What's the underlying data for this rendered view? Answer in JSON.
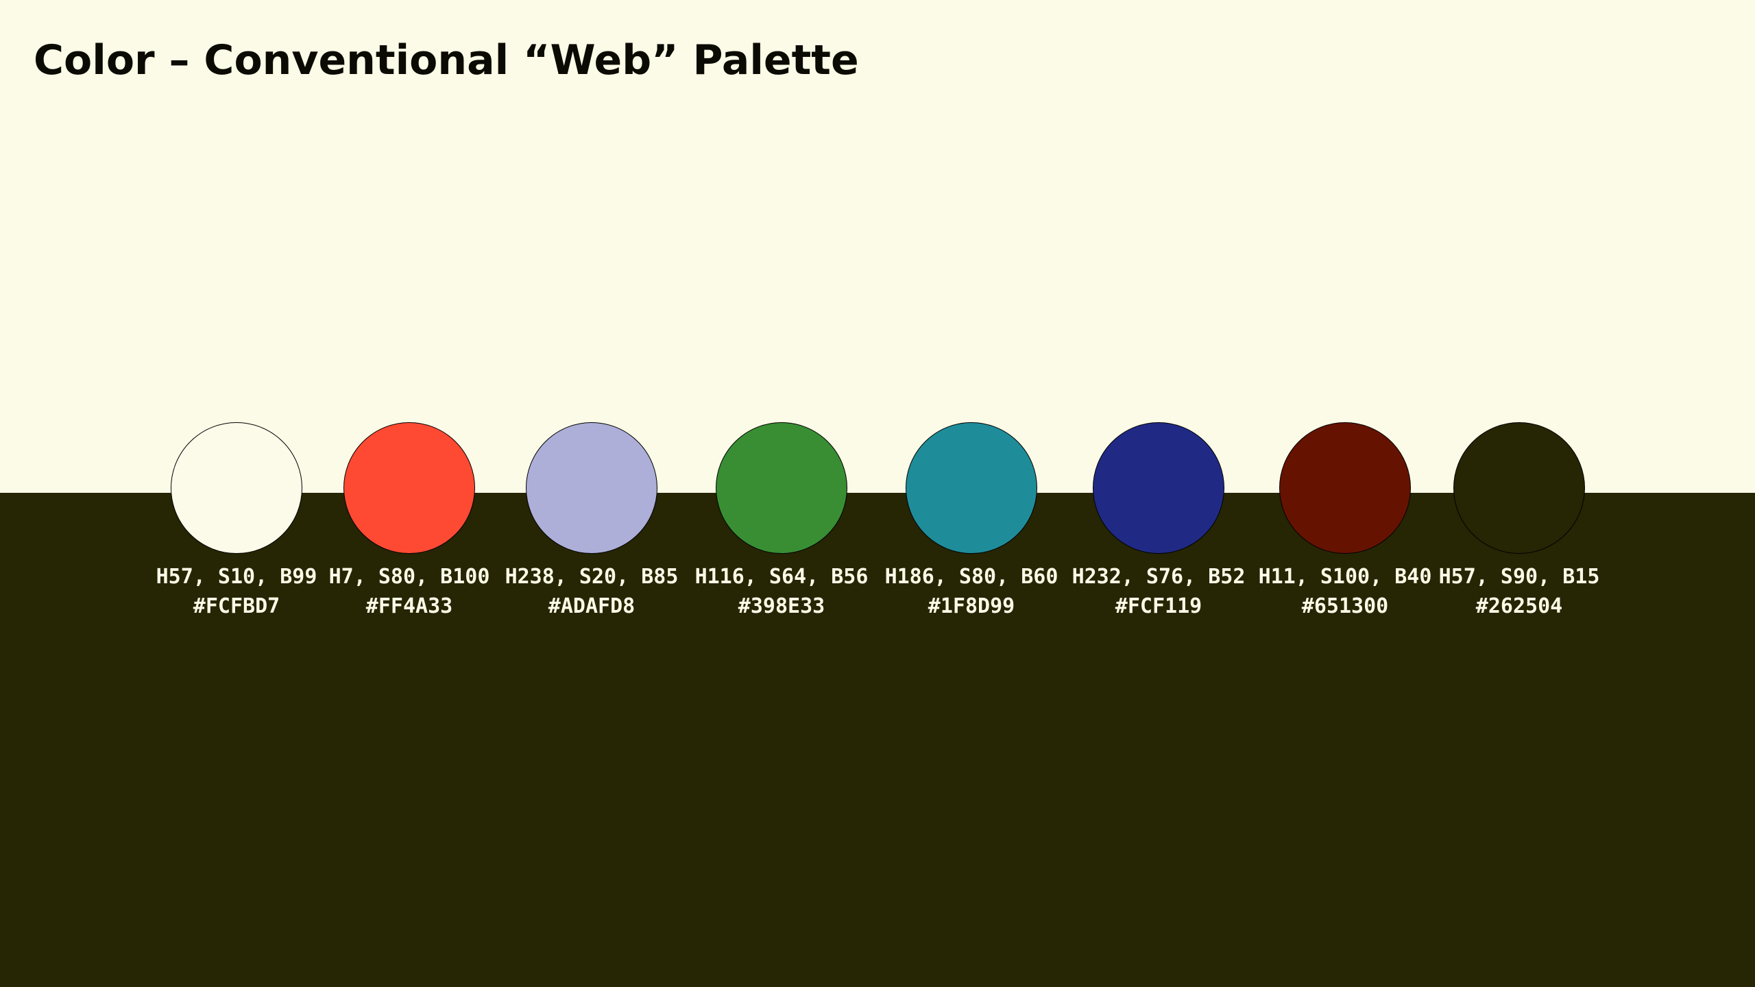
{
  "title": "Color – Conventional “Web” Palette",
  "colors": {
    "background_light": "#FCFBE7",
    "background_dark": "#262504",
    "label_text": "#FCFBE7",
    "title_text": "#0B0B04"
  },
  "swatches": [
    {
      "hsb": "H57, S10, B99",
      "hex": "#FCFBD7",
      "fill": "#FCFBE9"
    },
    {
      "hsb": "H7, S80, B100",
      "hex": "#FF4A33",
      "fill": "#FF4A33"
    },
    {
      "hsb": "H238, S20, B85",
      "hex": "#ADAFD8",
      "fill": "#ADAFD8"
    },
    {
      "hsb": "H116, S64, B56",
      "hex": "#398E33",
      "fill": "#398E33"
    },
    {
      "hsb": "H186, S80, B60",
      "hex": "#1F8D99",
      "fill": "#1F8D99"
    },
    {
      "hsb": "H232, S76, B52",
      "hex": "#FCF119",
      "fill": "#202A85"
    },
    {
      "hsb": "H11, S100, B40",
      "hex": "#651300",
      "fill": "#651300"
    },
    {
      "hsb": "H57, S90, B15",
      "hex": "#262504",
      "fill": "#262504"
    }
  ]
}
